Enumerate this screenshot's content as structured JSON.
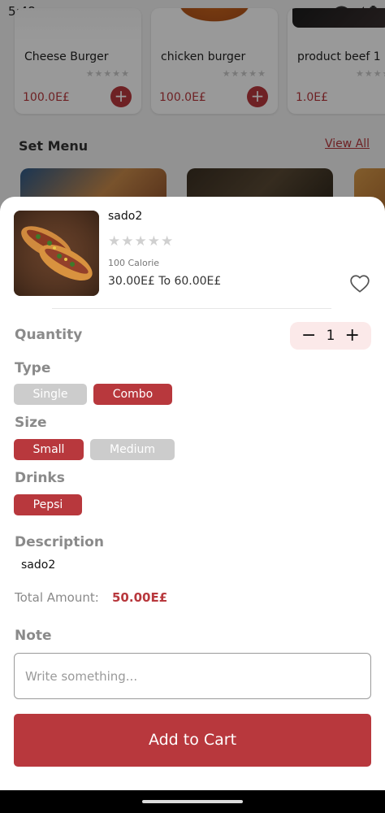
{
  "status_bar": {
    "time": "5:48"
  },
  "background": {
    "products": [
      {
        "name": "Cheese Burger",
        "stars": "★★★★★",
        "price": "100.0E£",
        "add": "+"
      },
      {
        "name": "chicken burger",
        "stars": "★★★★★",
        "price": "100.0E£",
        "add": "+"
      },
      {
        "name": "product  beef 1",
        "stars": "★★★★★",
        "price": "1.0E£"
      }
    ],
    "section_title": "Set Menu",
    "view_all": "View All"
  },
  "sheet": {
    "product": {
      "name": "sado2",
      "stars": "★★★★★",
      "rating": 0,
      "calories": "100 Calorie",
      "price_range": "30.00E£ To 60.00E£",
      "favorite_icon": "heart-outline-icon"
    },
    "quantity": {
      "label": "Quantity",
      "minus": "−",
      "value": "1",
      "plus": "+"
    },
    "type": {
      "label": "Type",
      "options": [
        "Single",
        "Combo"
      ],
      "selected": "Combo"
    },
    "size": {
      "label": "Size",
      "options": [
        "Small",
        "Medium"
      ],
      "selected": "Small"
    },
    "drinks": {
      "label": "Drinks",
      "options": [
        "Pepsi"
      ],
      "selected": "Pepsi"
    },
    "description": {
      "label": "Description",
      "text": "sado2"
    },
    "total": {
      "label": "Total Amount:",
      "value": "50.00E£"
    },
    "note": {
      "label": "Note",
      "placeholder": "Write something..."
    },
    "add_to_cart": "Add to Cart"
  },
  "colors": {
    "accent": "#b8383d",
    "chip_inactive": "#cccccc",
    "quantity_bg": "#fbe9e9"
  }
}
